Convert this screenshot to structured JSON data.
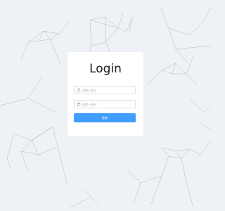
{
  "login": {
    "title": "Login",
    "username_placeholder": "请输入账号",
    "password_placeholder": "请输入密码",
    "submit_label": "登录"
  }
}
